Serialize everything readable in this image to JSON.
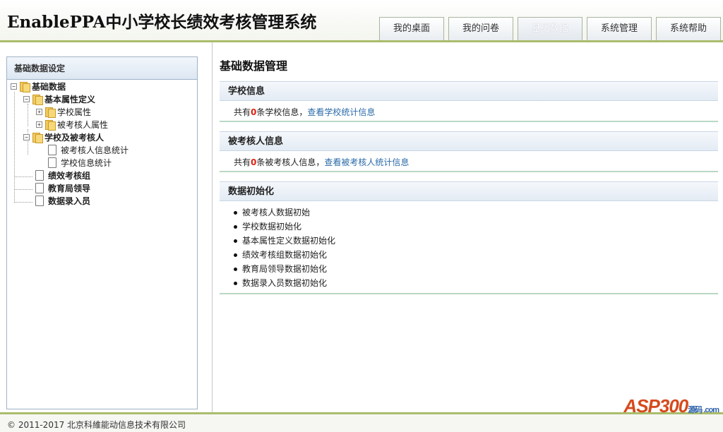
{
  "app": {
    "title": "EnablePPA中小学校长绩效考核管理系统"
  },
  "nav": {
    "tabs": [
      {
        "label": "我的桌面"
      },
      {
        "label": "我的问卷"
      },
      {
        "label": "基础数据"
      },
      {
        "label": "系统管理"
      },
      {
        "label": "系统帮助"
      }
    ],
    "active_index": 2
  },
  "sidebar": {
    "title": "基础数据设定",
    "tree": [
      {
        "label": "基础数据",
        "toggle": "−",
        "icon": "folder-icon"
      },
      {
        "label": "基本属性定义",
        "toggle": "−",
        "icon": "folder-icon"
      },
      {
        "label": "学校属性",
        "toggle": "+",
        "icon": "folder-icon"
      },
      {
        "label": "被考核人属性",
        "toggle": "+",
        "icon": "folder-icon"
      },
      {
        "label": "学校及被考核人",
        "toggle": "−",
        "icon": "folder-icon"
      },
      {
        "label": "被考核人信息统计",
        "icon": "document-icon"
      },
      {
        "label": "学校信息统计",
        "icon": "document-icon"
      },
      {
        "label": "绩效考核组",
        "icon": "document-icon"
      },
      {
        "label": "教育局领导",
        "icon": "document-icon"
      },
      {
        "label": "数据录入员",
        "icon": "document-icon"
      }
    ]
  },
  "main": {
    "title": "基础数据管理",
    "school": {
      "heading": "学校信息",
      "prefix": "共有",
      "count": "0",
      "suffix": "条学校信息，",
      "link": "查看学校统计信息"
    },
    "person": {
      "heading": "被考核人信息",
      "prefix": "共有",
      "count": "0",
      "suffix": "条被考核人信息，",
      "link": "查看被考核人统计信息"
    },
    "init": {
      "heading": "数据初始化",
      "items": [
        "被考核人数据初始",
        "学校数据初始化",
        "基本属性定义数据初始化",
        "绩效考核组数据初始化",
        "教育局领导数据初始化",
        "数据录入员数据初始化"
      ]
    }
  },
  "footer": {
    "copyright": "© 2011-2017 北京科維能动信息技术有限公司",
    "watermark": "ASP300",
    "watermark_sub": "源码 .com"
  },
  "colors": {
    "accent": "#a9bd6b",
    "link": "#2a6aa8",
    "count": "#d21111"
  }
}
